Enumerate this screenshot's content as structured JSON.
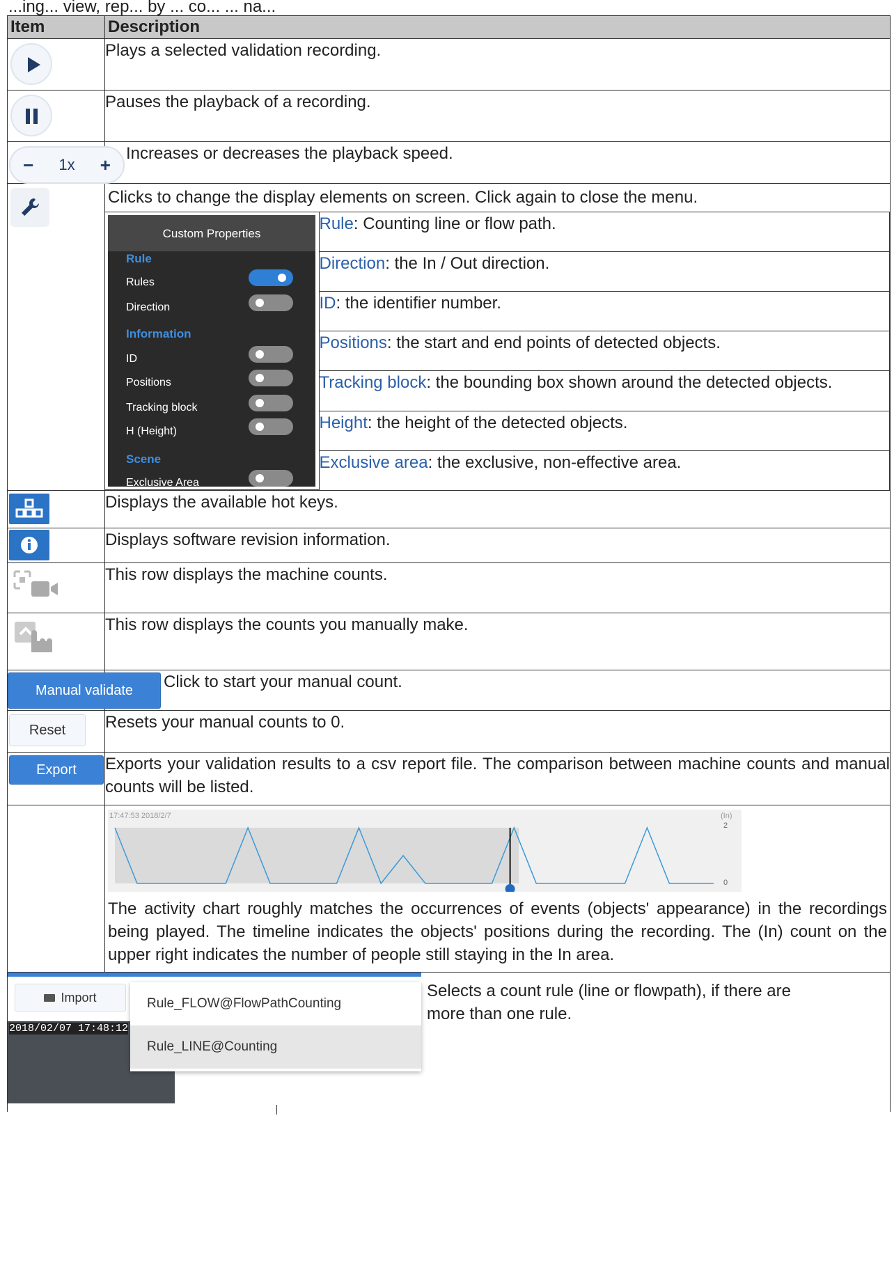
{
  "top_text": "...ing... view, rep... by ... co... ... na...",
  "header": {
    "item": "Item",
    "description": "Description"
  },
  "rows": {
    "play": "Plays a selected validation recording.",
    "pause": "Pauses the playback of a recording.",
    "speed": {
      "minus": "−",
      "value": "1x",
      "plus": "+",
      "desc": "Increases or decreases the playback speed."
    },
    "wrench": "Clicks to change the display elements on screen. Click again to close the menu.",
    "panel": {
      "title": "Custom Properties",
      "sec_rule": "Rule",
      "rules": "Rules",
      "direction": "Direction",
      "sec_info": "Information",
      "id": "ID",
      "positions": "Positions",
      "tracking": "Tracking block",
      "height": "H (Height)",
      "sec_scene": "Scene",
      "exclusive": "Exclusive Area"
    },
    "props": [
      {
        "term": "Rule",
        "rest": ": Counting line or flow path."
      },
      {
        "term": "Direction",
        "rest": ": the In / Out direction."
      },
      {
        "term": "ID",
        "rest": ": the identifier number."
      },
      {
        "term": "Positions",
        "rest": ": the start and end points of detected objects."
      },
      {
        "term": "Tracking block",
        "rest": ": the bounding box shown around the detected objects."
      },
      {
        "term": "Height",
        "rest": ": the height of the detected objects."
      },
      {
        "term": "Exclusive area",
        "rest": ": the exclusive, non-effective area."
      }
    ],
    "hotkeys": "Displays the available hot keys.",
    "info": "Displays software revision information.",
    "machine": "This row displays the machine counts.",
    "manual_row": "This row displays the counts you manually make.",
    "manual_validate": {
      "label": "Manual validate",
      "desc": "Click to start your manual count."
    },
    "reset": {
      "label": "Reset",
      "desc": "Resets your manual counts to 0."
    },
    "export": {
      "label": "Export",
      "desc": "Exports your validation results to a csv report file. The comparison between machine counts and manual counts will be listed."
    },
    "chart": {
      "timestamp": "17:47:53 2018/2/7",
      "in_label": "(In)",
      "tick_top": "2",
      "tick_bottom": "0",
      "desc": "The activity chart roughly matches the occurrences of events (objects' appearance) in the recordings being played. The timeline indicates the objects' positions during the recording. The (In) count on the upper right indicates the number of people still staying in the In area."
    },
    "rule_select": {
      "import": "Import",
      "option1": "Rule_FLOW@FlowPathCounting",
      "option2": "Rule_LINE@Counting",
      "video_time": "2018/02/07 17:48:12",
      "desc": "Selects a count rule (line or flowpath), if there are more than one rule."
    }
  },
  "chart_data": {
    "type": "line",
    "title": "",
    "x": [
      0,
      1,
      2,
      3,
      4,
      5,
      6,
      7,
      8,
      9,
      10,
      11,
      12,
      13,
      14,
      15,
      16,
      17,
      18,
      19,
      20,
      21,
      22,
      23,
      24,
      25,
      26,
      27
    ],
    "values": [
      2,
      0,
      0,
      0,
      0,
      0,
      2,
      0,
      0,
      0,
      0,
      2,
      0,
      1,
      0,
      0,
      0,
      0,
      2,
      0,
      0,
      0,
      0,
      0,
      2,
      0,
      0,
      0
    ],
    "ylim": [
      0,
      2
    ],
    "ylabel": "(In)",
    "playhead_fraction": 0.66
  }
}
